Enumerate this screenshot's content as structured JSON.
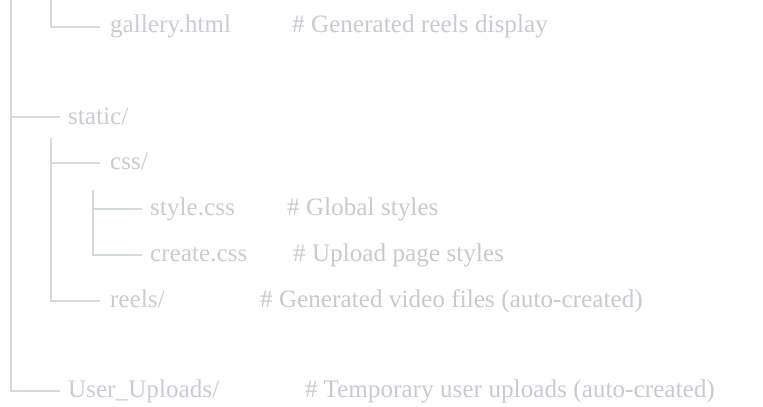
{
  "tree": [
    {
      "name": "gallery.html",
      "comment": "# Generated reels display"
    },
    {
      "name": "",
      "comment": ""
    },
    {
      "name": "static/",
      "comment": ""
    },
    {
      "name": "css/",
      "comment": ""
    },
    {
      "name": "style.css",
      "comment": "# Global styles"
    },
    {
      "name": "create.css",
      "comment": "# Upload page styles"
    },
    {
      "name": "reels/",
      "comment": "# Generated video files (auto-created)"
    },
    {
      "name": "",
      "comment": ""
    },
    {
      "name": "User_Uploads/",
      "comment": "# Temporary user uploads (auto-created)"
    }
  ]
}
